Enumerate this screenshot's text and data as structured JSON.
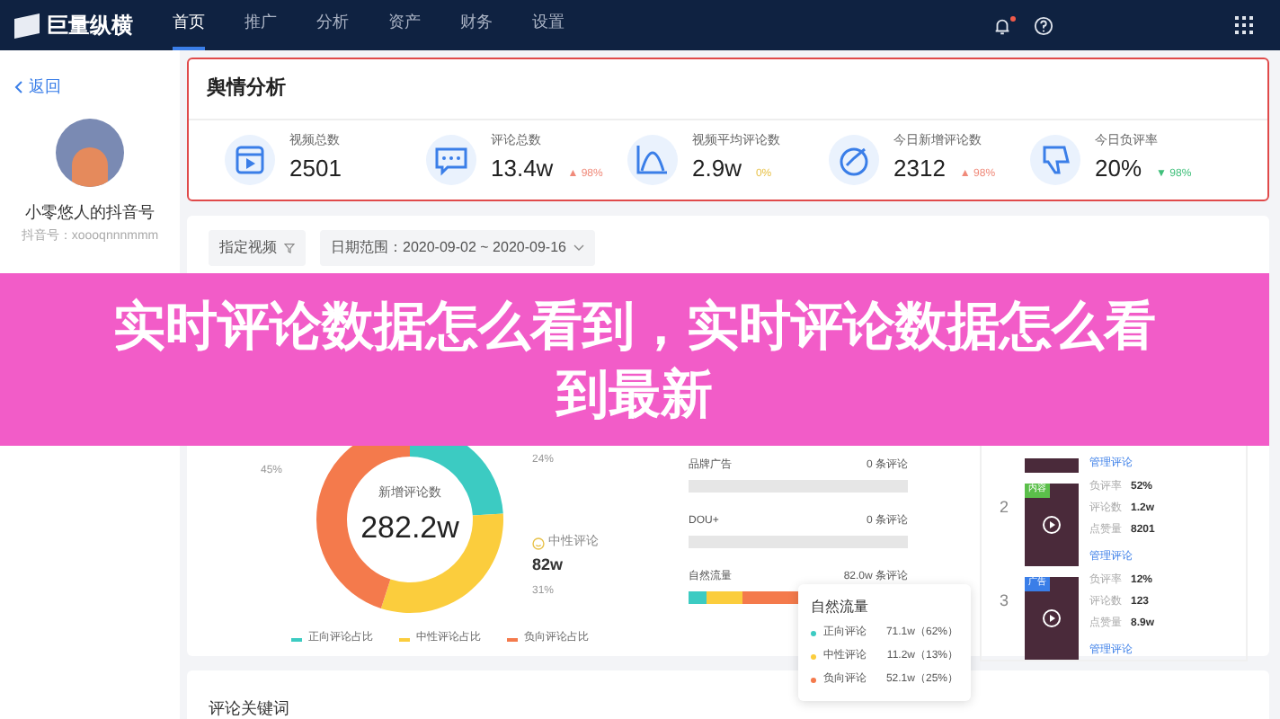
{
  "header": {
    "logo": "巨量纵横",
    "nav": [
      {
        "label": "首页",
        "selected": true
      },
      {
        "label": "推广",
        "selected": false
      },
      {
        "label": "分析",
        "selected": false
      },
      {
        "label": "资产",
        "selected": false
      },
      {
        "label": "财务",
        "selected": false
      },
      {
        "label": "设置",
        "selected": false
      }
    ],
    "notification_dot": true
  },
  "sidebar": {
    "back": "返回",
    "account_name": "小零悠人的抖音号",
    "account_id": "抖音号：xoooqnnnmmm"
  },
  "summary": {
    "title": "舆情分析",
    "stats": [
      {
        "kind": "video",
        "label": "视频总数",
        "value": "2501"
      },
      {
        "kind": "comment",
        "label": "评论总数",
        "value": "13.4w",
        "arrow": "▲",
        "change": "98%",
        "color": "#f08a7a"
      },
      {
        "kind": "curve",
        "label": "视频平均评论数",
        "value": "2.9w",
        "change": "0%",
        "color": "#e8c24a"
      },
      {
        "kind": "growth",
        "label": "今日新增评论数",
        "value": "2312",
        "arrow": "▲",
        "change": "98%",
        "color": "#f08a7a"
      },
      {
        "kind": "dislike",
        "label": "今日负评率",
        "value": "20%",
        "arrow": "▼",
        "change": "98%",
        "color": "#3fbf7a"
      }
    ]
  },
  "filters": {
    "video": "指定视频",
    "date": "日期范围：2020-09-02 ~ 2020-09-16"
  },
  "new_comments": {
    "center_label": "新增评论数",
    "center_value": "282.2w",
    "chart_data": {
      "type": "donut",
      "values": [
        24,
        31,
        45
      ],
      "colors": [
        "#3ccbc2",
        "#fbcd3d",
        "#f47a4c"
      ]
    },
    "callouts": [
      {
        "percent": "45%"
      },
      {
        "percent": "24%"
      },
      {
        "label": "中性评论",
        "value": "82w",
        "percent": "31%"
      }
    ],
    "legend": [
      "正向评论占比",
      "中性评论占比",
      "负向评论占比"
    ]
  },
  "traffic": {
    "sources": [
      {
        "label": "品牌广告",
        "count": "0 条评论"
      },
      {
        "label": "DOU+",
        "count": "0 条评论"
      },
      {
        "label": "自然流量",
        "count": "82.0w 条评论",
        "segments": [
          {
            "level": 0.08
          },
          {
            "level": 0.17
          },
          {
            "level": 0.75
          }
        ]
      }
    ],
    "tooltip": {
      "title": "自然流量",
      "rows": [
        {
          "label": "正向评论",
          "value": "71.1w（62%）"
        },
        {
          "label": "中性评论",
          "value": "11.2w（13%）"
        },
        {
          "label": "负向评论",
          "value": "52.1w（25%）"
        }
      ]
    }
  },
  "videos": {
    "items": [
      {
        "kind": "cut",
        "link": "管理评论"
      },
      {
        "kind": "full",
        "rank": "2",
        "tag": "内容",
        "color": "#5bbf4a",
        "link": "管理评论",
        "metrics": [
          {
            "label": "负评率",
            "value": "52%"
          },
          {
            "label": "评论数",
            "value": "1.2w"
          },
          {
            "label": "点赞量",
            "value": "8201"
          }
        ]
      },
      {
        "kind": "full",
        "rank": "3",
        "tag": "广告",
        "color": "#3a7ee8",
        "link": "管理评论",
        "metrics": [
          {
            "label": "负评率",
            "value": "12%"
          },
          {
            "label": "评论数",
            "value": "123"
          },
          {
            "label": "点赞量",
            "value": "8.9w"
          }
        ]
      }
    ]
  },
  "keywords": {
    "title": "评论关键词"
  },
  "banner": {
    "lines": [
      "实时评论数据怎么看到，实时评论数据怎么看",
      "到最新"
    ]
  }
}
